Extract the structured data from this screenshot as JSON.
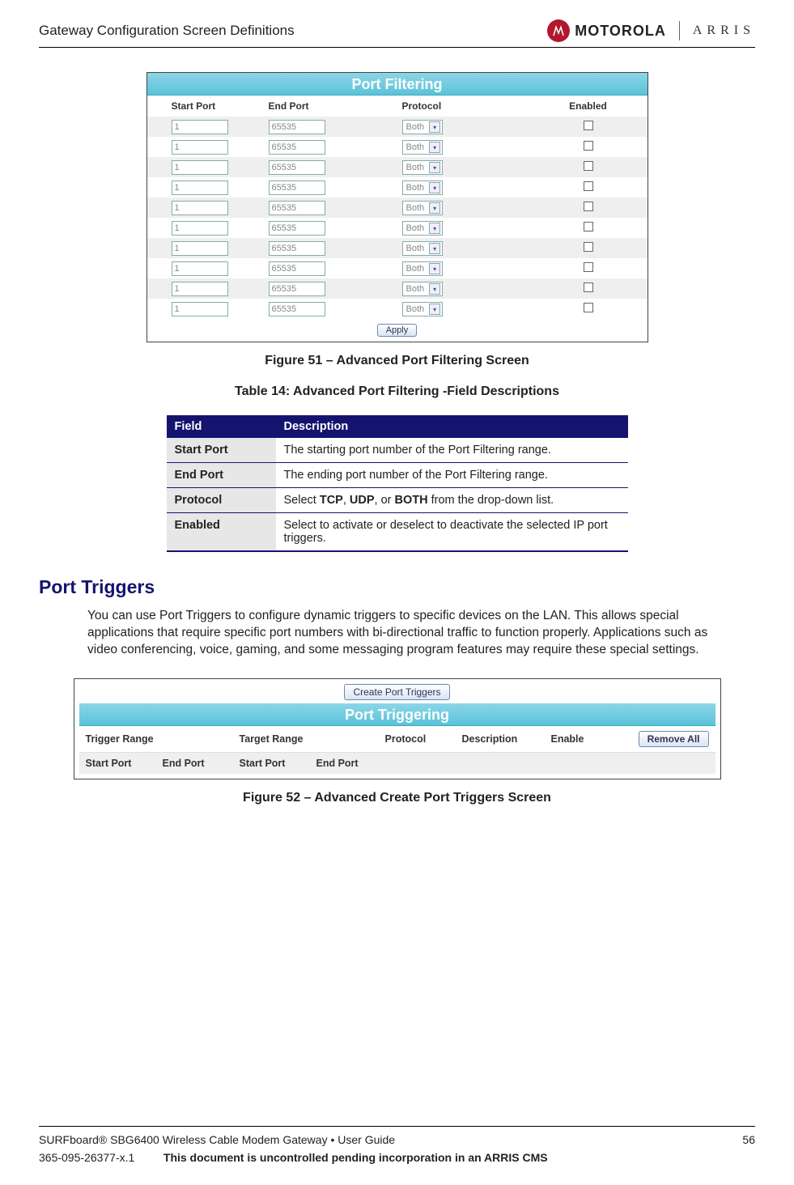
{
  "header": {
    "doc_section": "Gateway Configuration Screen Definitions",
    "brand1": "MOTOROLA",
    "brand2": "ARRIS"
  },
  "figure51": {
    "banner": "Port Filtering",
    "columns": [
      "Start Port",
      "End Port",
      "Protocol",
      "Enabled"
    ],
    "rows": [
      {
        "start": "1",
        "end": "65535",
        "protocol": "Both"
      },
      {
        "start": "1",
        "end": "65535",
        "protocol": "Both"
      },
      {
        "start": "1",
        "end": "65535",
        "protocol": "Both"
      },
      {
        "start": "1",
        "end": "65535",
        "protocol": "Both"
      },
      {
        "start": "1",
        "end": "65535",
        "protocol": "Both"
      },
      {
        "start": "1",
        "end": "65535",
        "protocol": "Both"
      },
      {
        "start": "1",
        "end": "65535",
        "protocol": "Both"
      },
      {
        "start": "1",
        "end": "65535",
        "protocol": "Both"
      },
      {
        "start": "1",
        "end": "65535",
        "protocol": "Both"
      },
      {
        "start": "1",
        "end": "65535",
        "protocol": "Both"
      }
    ],
    "apply": "Apply",
    "caption": "Figure 51 – Advanced Port Filtering Screen"
  },
  "table14": {
    "caption": "Table 14: Advanced Port Filtering -Field Descriptions",
    "head_field": "Field",
    "head_desc": "Description",
    "rows": [
      {
        "field": "Start Port",
        "desc": "The starting port number of the Port Filtering range."
      },
      {
        "field": "End Port",
        "desc": "The ending port number of the Port Filtering range."
      },
      {
        "field": "Protocol",
        "desc_pre": "Select ",
        "b1": "TCP",
        "mid1": ", ",
        "b2": "UDP",
        "mid2": ", or ",
        "b3": "BOTH",
        "desc_post": " from the drop-down list."
      },
      {
        "field": "Enabled",
        "desc": "Select to activate or deselect to deactivate the selected IP port triggers."
      }
    ]
  },
  "port_triggers": {
    "heading": "Port Triggers",
    "body": "You can use Port Triggers to configure dynamic triggers to specific devices on the LAN. This allows special applications that require specific port numbers with bi-directional traffic to function properly. Applications such as video conferencing, voice, gaming, and some messaging program features may require these special settings."
  },
  "figure52": {
    "create_btn": "Create Port Triggers",
    "banner": "Port Triggering",
    "row1": {
      "trigger": "Trigger Range",
      "target": "Target Range",
      "protocol": "Protocol",
      "description": "Description",
      "enable": "Enable",
      "remove_all": "Remove All"
    },
    "row2": {
      "sp": "Start Port",
      "ep": "End Port",
      "sp2": "Start Port",
      "ep2": "End Port"
    },
    "caption": "Figure 52 – Advanced Create Port Triggers Screen"
  },
  "footer": {
    "product": "SURFboard® SBG6400 Wireless Cable Modem Gateway • User Guide",
    "page": "56",
    "docnum": "365-095-26377-x.1",
    "notice": "This document is uncontrolled pending incorporation in an ARRIS CMS"
  }
}
